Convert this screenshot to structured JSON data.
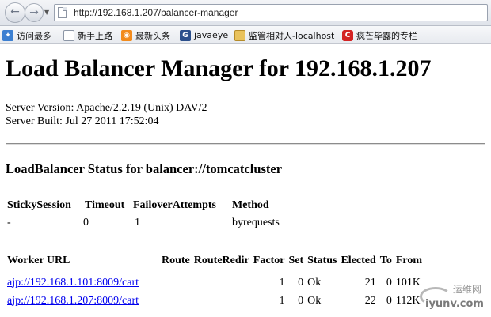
{
  "browser": {
    "url": "http://192.168.1.207/balancer-manager",
    "bookmarks": [
      "访问最多",
      "新手上路",
      "最新头条",
      "javaeye",
      "监管相对人-localhost",
      "疯芒毕露的专栏"
    ]
  },
  "page": {
    "title": "Load Balancer Manager for 192.168.1.207",
    "server_version": "Server Version: Apache/2.2.19 (Unix) DAV/2",
    "server_built": "Server Built: Jul 27 2011 17:52:04",
    "status_heading": "LoadBalancer Status for balancer://tomcatcluster",
    "balancer_table": {
      "headers": [
        "StickySession",
        "Timeout",
        "FailoverAttempts",
        "Method"
      ],
      "row": [
        "-",
        "0",
        "1",
        "byrequests"
      ]
    },
    "worker_table": {
      "headers": [
        "Worker URL",
        "Route",
        "RouteRedir",
        "Factor",
        "Set",
        "Status",
        "Elected",
        "To",
        "From"
      ],
      "rows": [
        [
          "ajp://192.168.1.101:8009/cart",
          "",
          "",
          "1",
          "0",
          "Ok",
          "21",
          "0",
          "101K"
        ],
        [
          "ajp://192.168.1.207:8009/cart",
          "",
          "",
          "1",
          "0",
          "Ok",
          "22",
          "0",
          "112K"
        ]
      ]
    }
  },
  "watermark": {
    "top": "运维网",
    "bottom": "iyunv.com"
  }
}
